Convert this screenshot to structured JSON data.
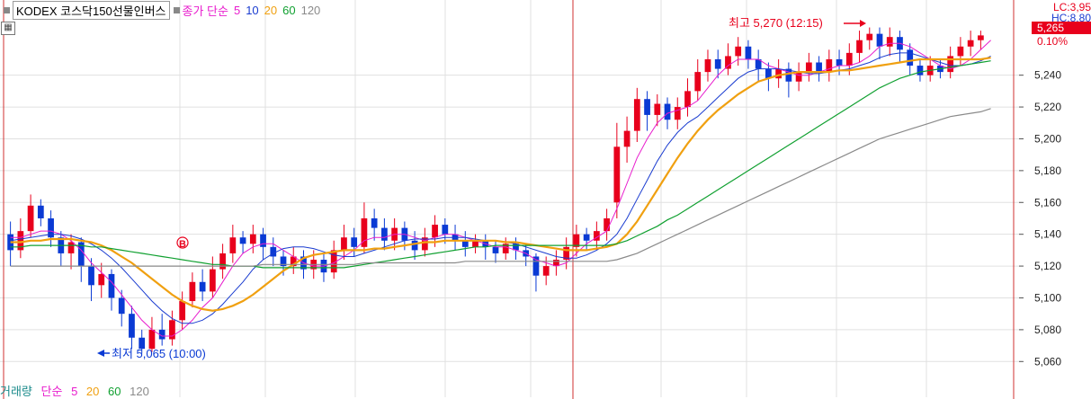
{
  "header": {
    "symbol_name": "KODEX 코스닥150선물인버스",
    "price_label": "종가 단순",
    "ma_periods": [
      "5",
      "10",
      "20",
      "60",
      "120"
    ]
  },
  "volume_legend": {
    "label": "거래량",
    "method": "단순",
    "ma_periods": [
      "5",
      "20",
      "60",
      "120"
    ]
  },
  "annotations": {
    "high": "최고 5,270 (12:15)",
    "low": "최저 5,065 (10:00)",
    "signal_marker": "B"
  },
  "right_info": {
    "lc": "LC:3,95",
    "hc": "HC:8,80",
    "current_price": "5,265",
    "change": "0.10%"
  },
  "colors": {
    "up": "#e8001c",
    "down": "#0a3ad4",
    "ma5": "#e81ccd",
    "ma10": "#1a3cd0",
    "ma20": "#f0a010",
    "ma60": "#10a030",
    "ma120": "#8a8a8a",
    "grid": "#e0e0e0",
    "session_line": "#d03030"
  },
  "chart_data": {
    "type": "candlestick",
    "y_ticks": [
      "5,240",
      "5,220",
      "5,200",
      "5,180",
      "5,160",
      "5,140",
      "5,120",
      "5,100",
      "5,080",
      "5,060"
    ],
    "ylim": [
      5050,
      5285
    ],
    "grid": true,
    "candles": [
      {
        "o": 5140,
        "c": 5130,
        "h": 5148,
        "l": 5120
      },
      {
        "o": 5130,
        "c": 5142,
        "h": 5150,
        "l": 5125
      },
      {
        "o": 5142,
        "c": 5158,
        "h": 5165,
        "l": 5138
      },
      {
        "o": 5158,
        "c": 5150,
        "h": 5162,
        "l": 5145
      },
      {
        "o": 5150,
        "c": 5138,
        "h": 5155,
        "l": 5132
      },
      {
        "o": 5138,
        "c": 5128,
        "h": 5142,
        "l": 5120
      },
      {
        "o": 5128,
        "c": 5135,
        "h": 5140,
        "l": 5118
      },
      {
        "o": 5135,
        "c": 5120,
        "h": 5138,
        "l": 5110
      },
      {
        "o": 5120,
        "c": 5108,
        "h": 5125,
        "l": 5098
      },
      {
        "o": 5108,
        "c": 5115,
        "h": 5122,
        "l": 5100
      },
      {
        "o": 5115,
        "c": 5100,
        "h": 5118,
        "l": 5092
      },
      {
        "o": 5100,
        "c": 5090,
        "h": 5105,
        "l": 5082
      },
      {
        "o": 5090,
        "c": 5075,
        "h": 5095,
        "l": 5068
      },
      {
        "o": 5075,
        "c": 5068,
        "h": 5080,
        "l": 5065
      },
      {
        "o": 5068,
        "c": 5080,
        "h": 5088,
        "l": 5066
      },
      {
        "o": 5080,
        "c": 5074,
        "h": 5090,
        "l": 5070
      },
      {
        "o": 5074,
        "c": 5086,
        "h": 5092,
        "l": 5070
      },
      {
        "o": 5086,
        "c": 5098,
        "h": 5104,
        "l": 5080
      },
      {
        "o": 5098,
        "c": 5110,
        "h": 5116,
        "l": 5094
      },
      {
        "o": 5110,
        "c": 5104,
        "h": 5118,
        "l": 5098
      },
      {
        "o": 5104,
        "c": 5118,
        "h": 5126,
        "l": 5100
      },
      {
        "o": 5118,
        "c": 5128,
        "h": 5134,
        "l": 5112
      },
      {
        "o": 5128,
        "c": 5138,
        "h": 5146,
        "l": 5122
      },
      {
        "o": 5138,
        "c": 5134,
        "h": 5142,
        "l": 5128
      },
      {
        "o": 5134,
        "c": 5140,
        "h": 5146,
        "l": 5128
      },
      {
        "o": 5140,
        "c": 5132,
        "h": 5144,
        "l": 5124
      },
      {
        "o": 5132,
        "c": 5126,
        "h": 5138,
        "l": 5120
      },
      {
        "o": 5126,
        "c": 5120,
        "h": 5130,
        "l": 5114
      },
      {
        "o": 5120,
        "c": 5126,
        "h": 5132,
        "l": 5115
      },
      {
        "o": 5126,
        "c": 5118,
        "h": 5130,
        "l": 5112
      },
      {
        "o": 5118,
        "c": 5124,
        "h": 5130,
        "l": 5112
      },
      {
        "o": 5124,
        "c": 5116,
        "h": 5128,
        "l": 5110
      },
      {
        "o": 5116,
        "c": 5130,
        "h": 5136,
        "l": 5112
      },
      {
        "o": 5130,
        "c": 5138,
        "h": 5146,
        "l": 5124
      },
      {
        "o": 5138,
        "c": 5132,
        "h": 5144,
        "l": 5126
      },
      {
        "o": 5132,
        "c": 5150,
        "h": 5160,
        "l": 5128
      },
      {
        "o": 5150,
        "c": 5144,
        "h": 5156,
        "l": 5136
      },
      {
        "o": 5144,
        "c": 5136,
        "h": 5150,
        "l": 5130
      },
      {
        "o": 5136,
        "c": 5144,
        "h": 5150,
        "l": 5130
      },
      {
        "o": 5144,
        "c": 5136,
        "h": 5148,
        "l": 5130
      },
      {
        "o": 5136,
        "c": 5130,
        "h": 5142,
        "l": 5124
      },
      {
        "o": 5130,
        "c": 5138,
        "h": 5144,
        "l": 5126
      },
      {
        "o": 5138,
        "c": 5146,
        "h": 5152,
        "l": 5132
      },
      {
        "o": 5146,
        "c": 5140,
        "h": 5150,
        "l": 5134
      },
      {
        "o": 5140,
        "c": 5136,
        "h": 5146,
        "l": 5130
      },
      {
        "o": 5136,
        "c": 5132,
        "h": 5142,
        "l": 5126
      },
      {
        "o": 5132,
        "c": 5136,
        "h": 5140,
        "l": 5128
      },
      {
        "o": 5136,
        "c": 5132,
        "h": 5140,
        "l": 5124
      },
      {
        "o": 5132,
        "c": 5128,
        "h": 5136,
        "l": 5122
      },
      {
        "o": 5128,
        "c": 5134,
        "h": 5138,
        "l": 5124
      },
      {
        "o": 5134,
        "c": 5130,
        "h": 5138,
        "l": 5124
      },
      {
        "o": 5130,
        "c": 5126,
        "h": 5134,
        "l": 5120
      },
      {
        "o": 5126,
        "c": 5114,
        "h": 5128,
        "l": 5104
      },
      {
        "o": 5114,
        "c": 5120,
        "h": 5126,
        "l": 5108
      },
      {
        "o": 5120,
        "c": 5124,
        "h": 5130,
        "l": 5114
      },
      {
        "o": 5124,
        "c": 5132,
        "h": 5138,
        "l": 5118
      },
      {
        "o": 5132,
        "c": 5140,
        "h": 5146,
        "l": 5126
      },
      {
        "o": 5140,
        "c": 5136,
        "h": 5144,
        "l": 5130
      },
      {
        "o": 5136,
        "c": 5142,
        "h": 5148,
        "l": 5130
      },
      {
        "o": 5142,
        "c": 5150,
        "h": 5156,
        "l": 5136
      },
      {
        "o": 5160,
        "c": 5195,
        "h": 5210,
        "l": 5150
      },
      {
        "o": 5195,
        "c": 5205,
        "h": 5214,
        "l": 5185
      },
      {
        "o": 5205,
        "c": 5225,
        "h": 5232,
        "l": 5198
      },
      {
        "o": 5225,
        "c": 5215,
        "h": 5230,
        "l": 5205
      },
      {
        "o": 5215,
        "c": 5222,
        "h": 5228,
        "l": 5208
      },
      {
        "o": 5222,
        "c": 5212,
        "h": 5226,
        "l": 5206
      },
      {
        "o": 5212,
        "c": 5220,
        "h": 5226,
        "l": 5206
      },
      {
        "o": 5220,
        "c": 5230,
        "h": 5238,
        "l": 5214
      },
      {
        "o": 5230,
        "c": 5242,
        "h": 5250,
        "l": 5224
      },
      {
        "o": 5242,
        "c": 5250,
        "h": 5256,
        "l": 5236
      },
      {
        "o": 5250,
        "c": 5244,
        "h": 5256,
        "l": 5238
      },
      {
        "o": 5244,
        "c": 5252,
        "h": 5260,
        "l": 5240
      },
      {
        "o": 5252,
        "c": 5258,
        "h": 5264,
        "l": 5246
      },
      {
        "o": 5258,
        "c": 5250,
        "h": 5262,
        "l": 5244
      },
      {
        "o": 5250,
        "c": 5244,
        "h": 5256,
        "l": 5236
      },
      {
        "o": 5244,
        "c": 5238,
        "h": 5248,
        "l": 5230
      },
      {
        "o": 5238,
        "c": 5244,
        "h": 5250,
        "l": 5232
      },
      {
        "o": 5244,
        "c": 5236,
        "h": 5248,
        "l": 5226
      },
      {
        "o": 5236,
        "c": 5242,
        "h": 5248,
        "l": 5230
      },
      {
        "o": 5242,
        "c": 5248,
        "h": 5254,
        "l": 5236
      },
      {
        "o": 5248,
        "c": 5242,
        "h": 5252,
        "l": 5236
      },
      {
        "o": 5242,
        "c": 5250,
        "h": 5256,
        "l": 5236
      },
      {
        "o": 5250,
        "c": 5246,
        "h": 5256,
        "l": 5240
      },
      {
        "o": 5246,
        "c": 5254,
        "h": 5260,
        "l": 5240
      },
      {
        "o": 5254,
        "c": 5262,
        "h": 5268,
        "l": 5248
      },
      {
        "o": 5262,
        "c": 5266,
        "h": 5270,
        "l": 5256
      },
      {
        "o": 5266,
        "c": 5258,
        "h": 5270,
        "l": 5250
      },
      {
        "o": 5258,
        "c": 5264,
        "h": 5270,
        "l": 5252
      },
      {
        "o": 5264,
        "c": 5256,
        "h": 5268,
        "l": 5248
      },
      {
        "o": 5256,
        "c": 5246,
        "h": 5260,
        "l": 5240
      },
      {
        "o": 5246,
        "c": 5240,
        "h": 5250,
        "l": 5236
      },
      {
        "o": 5240,
        "c": 5246,
        "h": 5252,
        "l": 5236
      },
      {
        "o": 5246,
        "c": 5242,
        "h": 5250,
        "l": 5238
      },
      {
        "o": 5242,
        "c": 5252,
        "h": 5258,
        "l": 5238
      },
      {
        "o": 5252,
        "c": 5258,
        "h": 5264,
        "l": 5246
      },
      {
        "o": 5258,
        "c": 5262,
        "h": 5268,
        "l": 5252
      },
      {
        "o": 5262,
        "c": 5265,
        "h": 5268,
        "l": 5256
      }
    ],
    "ma": [
      {
        "name": "5",
        "values": [
          5138,
          5138,
          5140,
          5142,
          5142,
          5140,
          5136,
          5130,
          5122,
          5116,
          5110,
          5102,
          5094,
          5086,
          5080,
          5076,
          5076,
          5080,
          5086,
          5094,
          5100,
          5110,
          5120,
          5128,
          5132,
          5134,
          5134,
          5130,
          5126,
          5122,
          5120,
          5120,
          5122,
          5126,
          5130,
          5136,
          5138,
          5138,
          5140,
          5140,
          5138,
          5136,
          5138,
          5140,
          5140,
          5138,
          5136,
          5134,
          5132,
          5132,
          5130,
          5128,
          5124,
          5122,
          5120,
          5122,
          5128,
          5134,
          5138,
          5142,
          5156,
          5172,
          5188,
          5200,
          5210,
          5216,
          5218,
          5220,
          5224,
          5232,
          5240,
          5246,
          5250,
          5250,
          5250,
          5246,
          5244,
          5242,
          5240,
          5240,
          5242,
          5244,
          5246,
          5246,
          5248,
          5252,
          5258,
          5260,
          5260,
          5258,
          5254,
          5250,
          5246,
          5244,
          5246,
          5250,
          5256,
          5262
        ]
      },
      {
        "name": "10",
        "values": [
          5136,
          5137,
          5138,
          5139,
          5140,
          5140,
          5139,
          5137,
          5134,
          5130,
          5125,
          5119,
          5112,
          5105,
          5098,
          5092,
          5087,
          5084,
          5084,
          5086,
          5090,
          5096,
          5103,
          5110,
          5118,
          5124,
          5128,
          5131,
          5132,
          5132,
          5131,
          5129,
          5127,
          5126,
          5126,
          5128,
          5130,
          5132,
          5134,
          5136,
          5137,
          5137,
          5137,
          5138,
          5138,
          5138,
          5137,
          5136,
          5136,
          5135,
          5134,
          5132,
          5130,
          5128,
          5126,
          5125,
          5125,
          5127,
          5130,
          5134,
          5140,
          5150,
          5162,
          5174,
          5186,
          5196,
          5204,
          5210,
          5214,
          5220,
          5226,
          5232,
          5238,
          5242,
          5244,
          5244,
          5244,
          5243,
          5242,
          5241,
          5241,
          5242,
          5243,
          5244,
          5246,
          5248,
          5251,
          5253,
          5254,
          5254,
          5252,
          5250,
          5248,
          5246,
          5246,
          5247,
          5249,
          5252
        ]
      },
      {
        "name": "20",
        "values": [
          5135,
          5135,
          5136,
          5136,
          5137,
          5137,
          5137,
          5136,
          5135,
          5133,
          5130,
          5126,
          5122,
          5117,
          5112,
          5107,
          5102,
          5098,
          5095,
          5093,
          5092,
          5093,
          5095,
          5098,
          5102,
          5107,
          5112,
          5117,
          5121,
          5125,
          5127,
          5128,
          5129,
          5130,
          5130,
          5130,
          5131,
          5131,
          5132,
          5133,
          5134,
          5135,
          5135,
          5136,
          5136,
          5136,
          5136,
          5136,
          5136,
          5135,
          5135,
          5134,
          5133,
          5132,
          5131,
          5130,
          5130,
          5130,
          5131,
          5132,
          5134,
          5140,
          5148,
          5158,
          5168,
          5178,
          5188,
          5197,
          5205,
          5212,
          5218,
          5223,
          5228,
          5232,
          5236,
          5238,
          5240,
          5241,
          5242,
          5242,
          5242,
          5242,
          5243,
          5243,
          5244,
          5245,
          5246,
          5247,
          5248,
          5249,
          5250,
          5250,
          5250,
          5250,
          5250,
          5250,
          5250,
          5251
        ]
      },
      {
        "name": "60",
        "values": [
          5132,
          5132,
          5133,
          5133,
          5133,
          5133,
          5133,
          5133,
          5132,
          5132,
          5131,
          5130,
          5129,
          5128,
          5127,
          5126,
          5125,
          5124,
          5123,
          5122,
          5121,
          5121,
          5120,
          5120,
          5120,
          5119,
          5119,
          5119,
          5119,
          5119,
          5119,
          5119,
          5119,
          5119,
          5120,
          5121,
          5122,
          5123,
          5124,
          5125,
          5126,
          5127,
          5128,
          5129,
          5130,
          5131,
          5132,
          5132,
          5133,
          5133,
          5133,
          5133,
          5133,
          5133,
          5133,
          5133,
          5133,
          5133,
          5133,
          5133,
          5134,
          5136,
          5139,
          5142,
          5145,
          5149,
          5152,
          5156,
          5160,
          5164,
          5168,
          5172,
          5176,
          5180,
          5184,
          5188,
          5192,
          5196,
          5200,
          5204,
          5208,
          5212,
          5216,
          5220,
          5224,
          5228,
          5232,
          5235,
          5238,
          5240,
          5242,
          5243,
          5244,
          5245,
          5246,
          5247,
          5248,
          5249
        ]
      },
      {
        "name": "120",
        "values": [
          5120,
          5120,
          5120,
          5120,
          5120,
          5120,
          5120,
          5120,
          5120,
          5120,
          5120,
          5120,
          5120,
          5120,
          5120,
          5120,
          5120,
          5120,
          5120,
          5120,
          5120,
          5120,
          5120,
          5120,
          5120,
          5121,
          5121,
          5121,
          5121,
          5121,
          5121,
          5121,
          5121,
          5121,
          5121,
          5122,
          5122,
          5122,
          5122,
          5122,
          5122,
          5122,
          5122,
          5122,
          5122,
          5123,
          5123,
          5123,
          5123,
          5123,
          5123,
          5123,
          5123,
          5123,
          5123,
          5123,
          5123,
          5123,
          5123,
          5123,
          5124,
          5126,
          5128,
          5131,
          5134,
          5137,
          5140,
          5143,
          5146,
          5149,
          5152,
          5155,
          5158,
          5161,
          5164,
          5167,
          5170,
          5173,
          5176,
          5179,
          5182,
          5185,
          5188,
          5191,
          5194,
          5197,
          5200,
          5202,
          5204,
          5206,
          5208,
          5210,
          5212,
          5214,
          5215,
          5216,
          5217,
          5219
        ]
      }
    ]
  }
}
